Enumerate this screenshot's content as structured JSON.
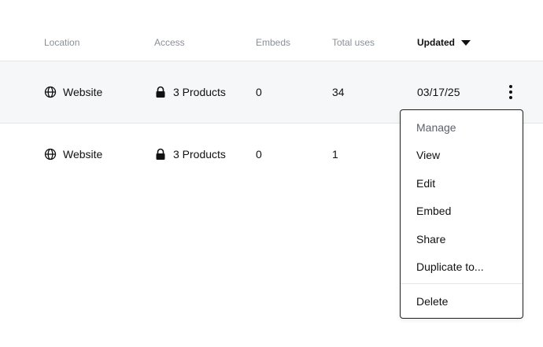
{
  "table": {
    "columns": {
      "location": "Location",
      "access": "Access",
      "embeds": "Embeds",
      "total_uses": "Total uses",
      "updated": "Updated"
    },
    "rows": [
      {
        "location": "Website",
        "access": "3 Products",
        "embeds": "0",
        "total_uses": "34",
        "updated": "03/17/25"
      },
      {
        "location": "Website",
        "access": "3 Products",
        "embeds": "0",
        "total_uses": "1",
        "updated": ""
      }
    ]
  },
  "menu": {
    "items": [
      "Manage",
      "View",
      "Edit",
      "Embed",
      "Share",
      "Duplicate to...",
      "Delete"
    ]
  },
  "icons": {
    "location": "globe-icon",
    "access": "lock-icon",
    "row_menu": "kebab-menu-icon",
    "sort": "caret-down-icon"
  },
  "colors": {
    "row_highlight": "#f6f7f8",
    "header_text": "#8a8f98",
    "text": "#111111"
  }
}
